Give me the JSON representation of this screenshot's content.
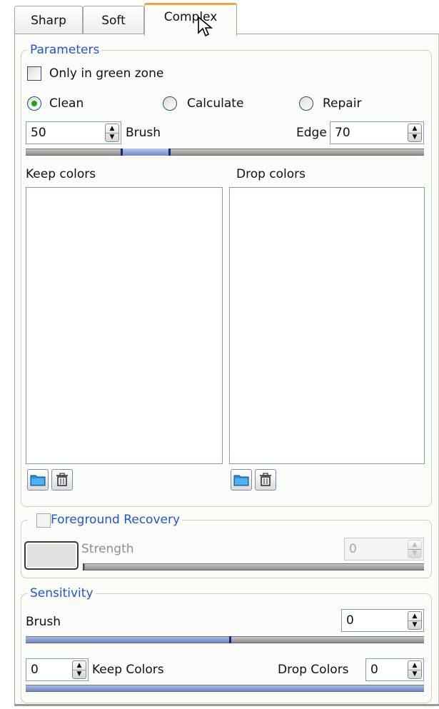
{
  "tabs": [
    {
      "label": "Sharp"
    },
    {
      "label": "Soft"
    },
    {
      "label": "Complex"
    }
  ],
  "parameters": {
    "title": "Parameters",
    "only_green_zone_label": "Only in green zone",
    "only_green_zone_checked": false,
    "mode_options": [
      "Clean",
      "Calculate",
      "Repair"
    ],
    "mode_selected": "Clean",
    "brush_value": "50",
    "brush_label": "Brush",
    "edge_label": "Edge",
    "edge_value": "70",
    "keep_colors_label": "Keep colors",
    "drop_colors_label": "Drop colors"
  },
  "foreground_recovery": {
    "title": "Foreground Recovery",
    "checked": false,
    "strength_label": "Strength",
    "strength_value": "0"
  },
  "sensitivity": {
    "title": "Sensitivity",
    "brush_label": "Brush",
    "brush_value": "0",
    "brush_slider_fraction": 0.51,
    "keep_colors_value": "0",
    "keep_colors_label": "Keep Colors",
    "drop_colors_label": "Drop Colors",
    "drop_colors_value": "0"
  },
  "icons": {
    "open": "folder-icon",
    "delete": "trash-icon",
    "spin_up": "▲",
    "spin_down": "▼"
  },
  "colors": {
    "accent_blue": "#1f55d4",
    "active_tab_line": "#f2a23a",
    "radio_dot": "#21a121",
    "slider_fill": "#6f88c6"
  }
}
